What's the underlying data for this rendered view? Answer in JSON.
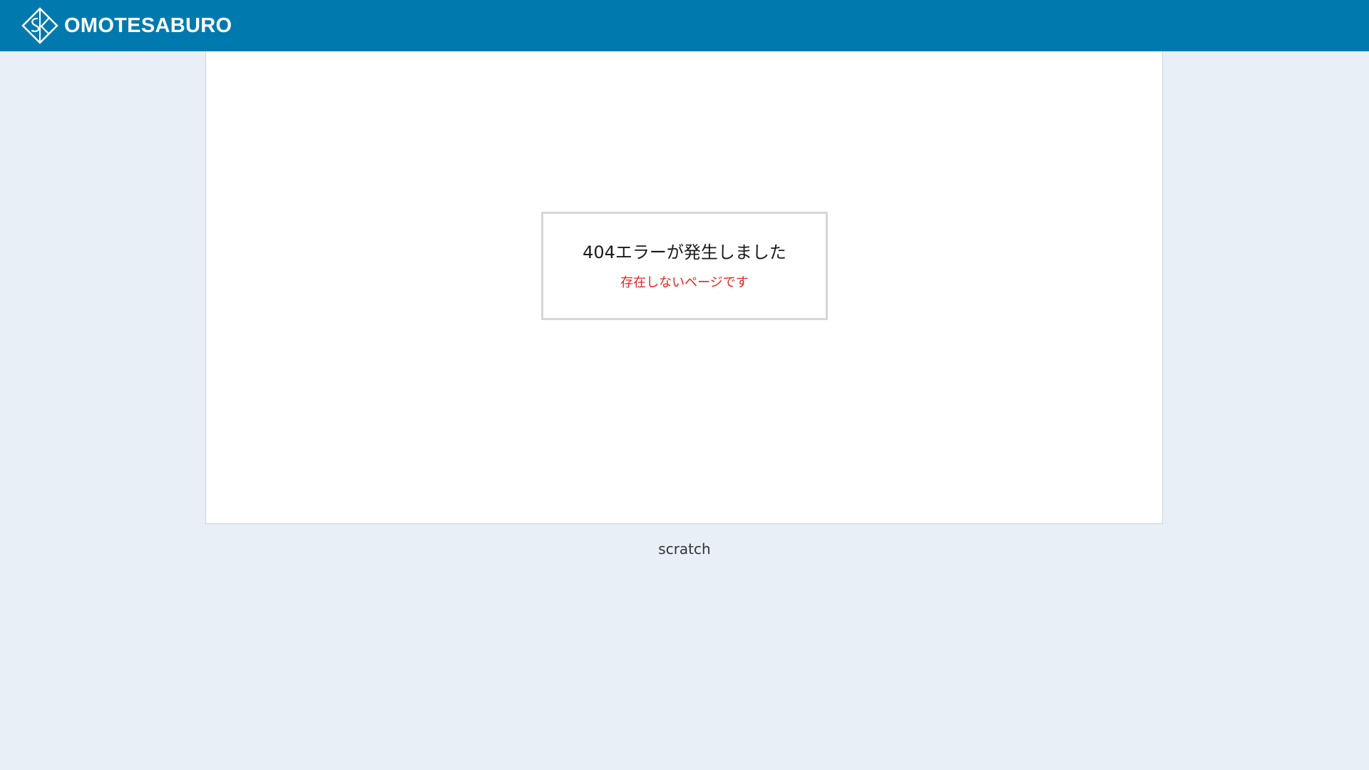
{
  "header": {
    "brand_name": "OMOTESABURO",
    "logo_icon": "sk-diamond-logo-icon",
    "background_color": "#007aae"
  },
  "error": {
    "title": "404エラーが発生しました",
    "message": "存在しないページです",
    "message_color": "#e8231f"
  },
  "footer": {
    "link_text": "scratch"
  },
  "colors": {
    "page_background": "#e8eff6",
    "panel_background": "#ffffff"
  }
}
